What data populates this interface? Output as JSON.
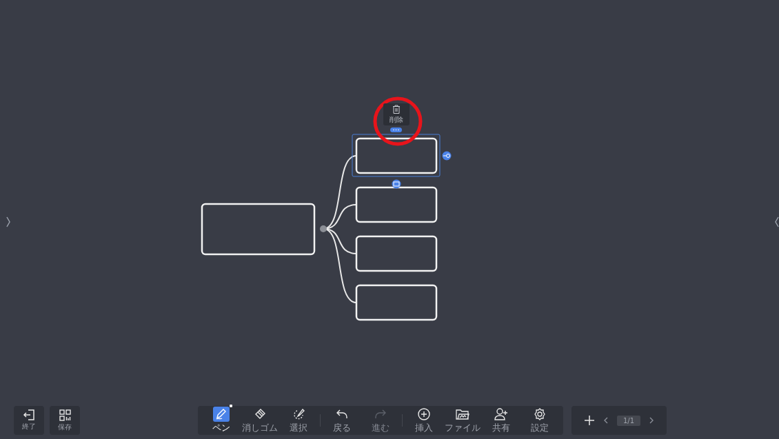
{
  "left_buttons": [
    {
      "label": "終了"
    },
    {
      "label": "保存"
    }
  ],
  "tools": [
    {
      "label": "ペン",
      "selected": true,
      "disabled": false
    },
    {
      "label": "消しゴム",
      "selected": false,
      "disabled": false
    },
    {
      "label": "選択",
      "selected": false,
      "disabled": false
    },
    {
      "label": "戻る",
      "selected": false,
      "disabled": false
    },
    {
      "label": "進む",
      "selected": false,
      "disabled": true
    },
    {
      "label": "挿入",
      "selected": false,
      "disabled": false
    },
    {
      "label": "ファイル",
      "selected": false,
      "disabled": false
    },
    {
      "label": "共有",
      "selected": false,
      "disabled": false
    },
    {
      "label": "設定",
      "selected": false,
      "disabled": false
    }
  ],
  "pager": {
    "page": "1/1"
  },
  "popup": {
    "label": "削除"
  },
  "mindmap": {
    "children": [
      {
        "selected": true
      },
      {
        "selected": false
      },
      {
        "selected": false
      },
      {
        "selected": false
      }
    ]
  }
}
